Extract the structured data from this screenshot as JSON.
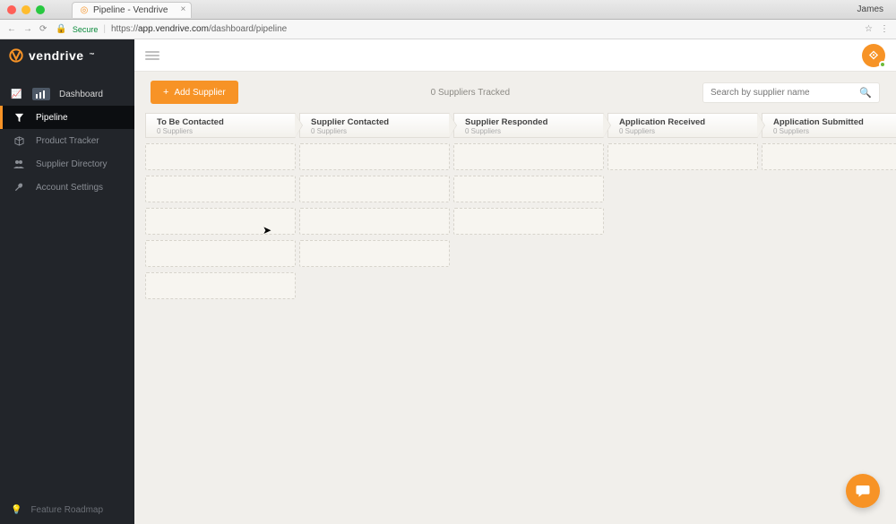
{
  "browser": {
    "tab_title": "Pipeline - Vendrive",
    "profile": "James",
    "secure_label": "Secure",
    "url_prefix": "https://",
    "url_host": "app.vendrive.com",
    "url_path": "/dashboard/pipeline"
  },
  "brand": {
    "name": "vendrive",
    "accent": "#f79326"
  },
  "sidebar": {
    "items": [
      {
        "label": "Dashboard",
        "key": "dashboard"
      },
      {
        "label": "Pipeline",
        "key": "pipeline"
      },
      {
        "label": "Product Tracker",
        "key": "product-tracker"
      },
      {
        "label": "Supplier Directory",
        "key": "supplier-directory"
      },
      {
        "label": "Account Settings",
        "key": "account-settings"
      }
    ],
    "feature_roadmap": "Feature Roadmap"
  },
  "controls": {
    "add_supplier": "Add Supplier",
    "tracked": "0 Suppliers Tracked",
    "search_placeholder": "Search by supplier name"
  },
  "stages": [
    {
      "title": "To Be Contacted",
      "count": "0 Suppliers",
      "placeholders": 5
    },
    {
      "title": "Supplier Contacted",
      "count": "0 Suppliers",
      "placeholders": 4
    },
    {
      "title": "Supplier Responded",
      "count": "0 Suppliers",
      "placeholders": 3
    },
    {
      "title": "Application Received",
      "count": "0 Suppliers",
      "placeholders": 1
    },
    {
      "title": "Application Submitted",
      "count": "0 Suppliers",
      "placeholders": 1
    }
  ]
}
